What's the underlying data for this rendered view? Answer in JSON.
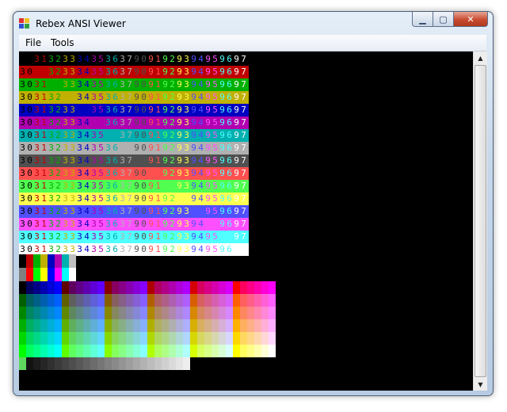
{
  "window": {
    "title": "Rebex ANSI Viewer",
    "minimize_label": "▁",
    "maximize_label": "▢",
    "close_label": "✕"
  },
  "menu": {
    "items": [
      "File",
      "Tools"
    ]
  },
  "icons": {
    "app": "rebex-app-icon",
    "scroll_up": "arrow-up-icon",
    "scroll_down": "arrow-down-icon"
  },
  "terminal": {
    "row_text": "303132333435363790919293949596 97",
    "row_backgrounds": [
      "#000000",
      "#c00000",
      "#00b000",
      "#c0b000",
      "#0000c0",
      "#b000b0",
      "#00b0b0",
      "#b0b0b0",
      "#505050",
      "#ff5050",
      "#50ff50",
      "#ffff50",
      "#5050ff",
      "#ff50ff",
      "#50ffff",
      "#ffffff"
    ],
    "fg_colors": [
      "#000000",
      "#c00000",
      "#00b000",
      "#c0b000",
      "#0000c0",
      "#b000b0",
      "#00b0b0",
      "#b0b0b0",
      "#505050",
      "#ff5050",
      "#50ff50",
      "#ffff50",
      "#5050ff",
      "#ff50ff",
      "#50ffff",
      "#ffffff"
    ],
    "basic_palette": [
      "#000000",
      "#c00000",
      "#00b000",
      "#c0b000",
      "#0000c0",
      "#b000b0",
      "#00b0b0",
      "#c0c0c0",
      "#808080",
      "#ff0000",
      "#00ff00",
      "#ffff00",
      "#0000ff",
      "#ff00ff",
      "#00ffff",
      "#ffffff"
    ],
    "cube_levels": [
      "#00",
      "#5f",
      "#87",
      "#af",
      "#d7",
      "#ff"
    ]
  }
}
